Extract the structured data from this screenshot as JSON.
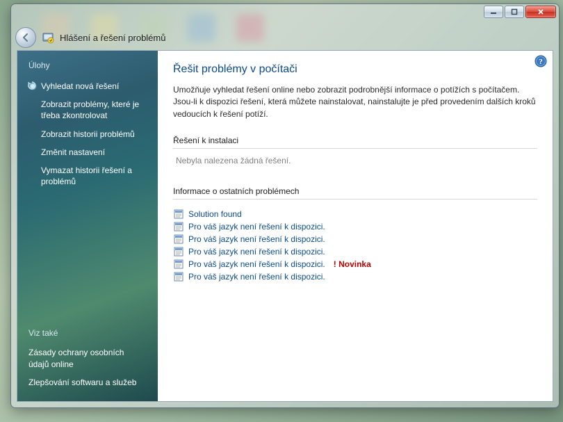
{
  "window": {
    "breadcrumb": "Hlášení a řešení problémů"
  },
  "sidebar": {
    "tasks_heading": "Úlohy",
    "items": [
      {
        "label": "Vyhledat nová řešení",
        "active": true
      },
      {
        "label": "Zobrazit problémy, které je třeba zkontrolovat"
      },
      {
        "label": "Zobrazit historii problémů"
      },
      {
        "label": "Změnit nastavení"
      },
      {
        "label": "Vymazat historii řešení a problémů"
      }
    ],
    "see_also_heading": "Viz také",
    "see_also": [
      {
        "label": "Zásady ochrany osobních údajů online"
      },
      {
        "label": "Zlepšování softwaru a služeb"
      }
    ]
  },
  "main": {
    "title": "Řešit problémy v počítači",
    "description": "Umožňuje vyhledat řešení online nebo zobrazit podrobnější informace o potížích s počítačem. Jsou-li k dispozici řešení, která můžete nainstalovat, nainstalujte je před provedením dalších kroků vedoucích k řešení potíží.",
    "install_heading": "Řešení k instalaci",
    "install_empty": "Nebyla nalezena žádná řešení.",
    "info_heading": "Informace o ostatních problémech",
    "problems": [
      {
        "label": "Solution found",
        "badge": ""
      },
      {
        "label": "Pro váš jazyk není řešení k dispozici.",
        "badge": ""
      },
      {
        "label": "Pro váš jazyk není řešení k dispozici.",
        "badge": ""
      },
      {
        "label": "Pro váš jazyk není řešení k dispozici.",
        "badge": ""
      },
      {
        "label": "Pro váš jazyk není řešení k dispozici.",
        "badge": "! Novinka"
      },
      {
        "label": "Pro váš jazyk není řešení k dispozici.",
        "badge": ""
      }
    ]
  }
}
